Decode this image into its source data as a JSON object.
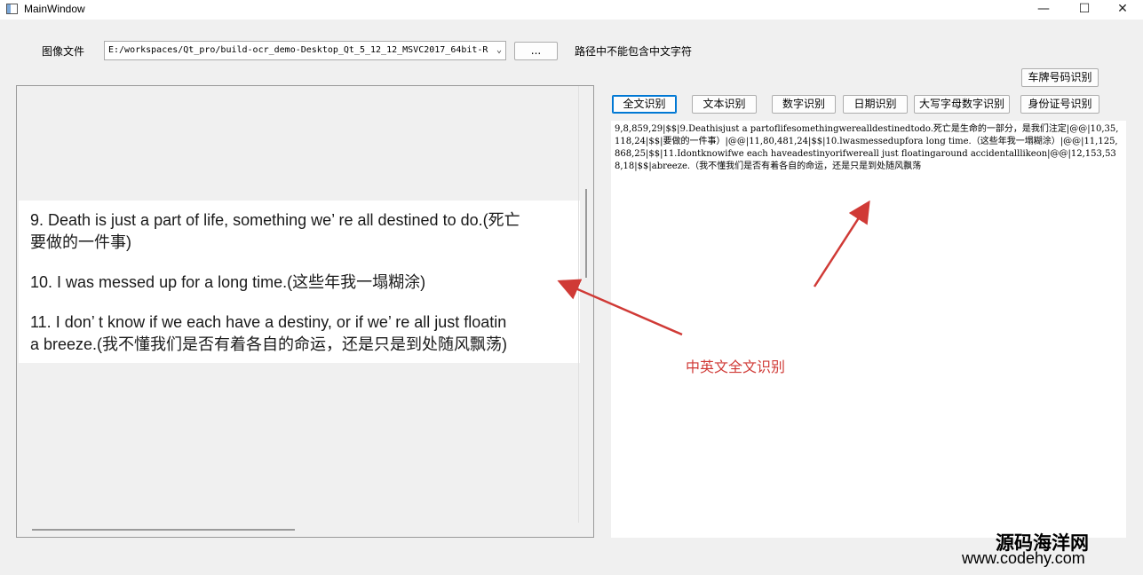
{
  "window": {
    "title": "MainWindow",
    "minimize": "—",
    "maximize": "☐",
    "close": "✕"
  },
  "toolbar": {
    "file_label": "图像文件",
    "path_value": "E:/workspaces/Qt_pro/build-ocr_demo-Desktop_Qt_5_12_12_MSVC2017_64bit-R",
    "browse_label": "...",
    "path_hint": "路径中不能包含中文字符"
  },
  "buttons": {
    "plate": "车牌号码识别",
    "full": "全文识别",
    "text": "文本识别",
    "digits": "数字识别",
    "date": "日期识别",
    "upper_digits": "大写字母数字识别",
    "id_card": "身份证号识别"
  },
  "image": {
    "line1": "9.   Death is just a part of life, something we’  re all destined to do.(死亡",
    "line2": "要做的一件事)",
    "line3": "10.   I was messed up for a long time.(这些年我一塌糊涂)",
    "line4": "11.   I don’  t know if we each have a destiny, or if we’  re all just floatin",
    "line5": "a breeze.(我不懂我们是否有着各自的命运，还是只是到处随风飘荡)"
  },
  "result": {
    "text": "9,8,859,29|$$|9.Deathisjust a partoflifesomethingwerealldestinedtodo.死亡是生命的一部分，是我们注定|@@|10,35,118,24|$$|要做的一件事）|@@|11,80,481,24|$$|10.lwasmessedupfora long time.（这些年我一塌糊涂）|@@|11,125,868,25|$$|11.Idontknowifwe each haveadestinyorifwereall just floatingaround accidentalllikeon|@@|12,153,538,18|$$|abreeze.（我不懂我们是否有着各自的命运，还是只是到处随风飘荡"
  },
  "annotation": "中英文全文识别",
  "watermark": {
    "cn": "源码海洋网",
    "url": "www.codehy.com"
  },
  "colors": {
    "accent": "#0078d4",
    "annotation": "#d03a36"
  }
}
